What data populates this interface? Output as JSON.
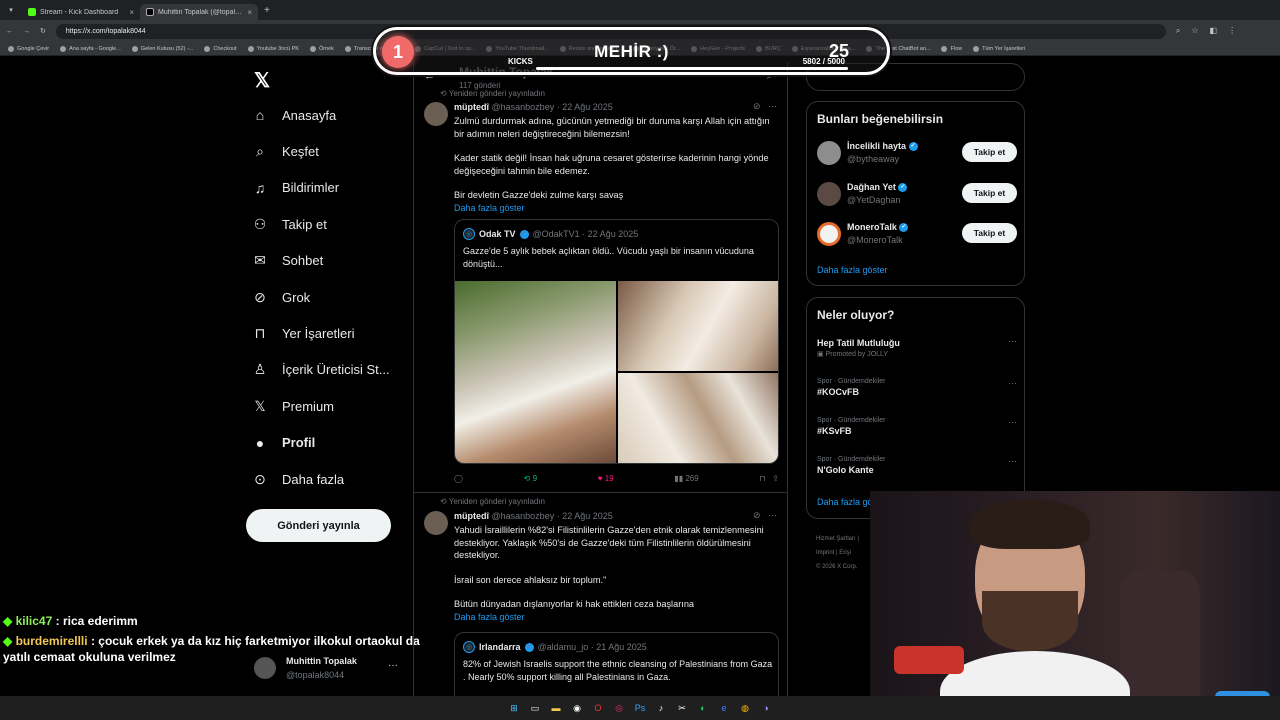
{
  "browser": {
    "tabs": [
      {
        "title": "Stream - Kick Dashboard",
        "icon": "kick-icon"
      },
      {
        "title": "Muhittin Topalak (@topalak804...",
        "icon": "x-icon"
      }
    ],
    "url": "https://x.com/topalak8044",
    "bookmarks": [
      "Google Çevir",
      "Ana sayfa - Google...",
      "Gelen Kutusu (52) -...",
      "Checkout",
      "Youtube 3ncü PK",
      "Örnek",
      "Transcript of \"Mi M...",
      "CapCut | Text to sp...",
      "YouTube Thumbnail...",
      "Resize and reduce i...",
      "İspanyolca Ör...",
      "HeyGen - Projects",
      "BURÇ",
      "Esperanza000 Strea...",
      "The best ChatBot an...",
      "Flow",
      "Tüm Yer İşaretleri"
    ]
  },
  "overlay": {
    "badge": "1",
    "name": "MEHİR :)",
    "target": "25",
    "label": "KICKS",
    "count": "5802 / 5000",
    "progress": 1.0
  },
  "x_nav": {
    "items": [
      {
        "label": "Anasayfa",
        "icon": "home-icon"
      },
      {
        "label": "Keşfet",
        "icon": "search-icon"
      },
      {
        "label": "Bildirimler",
        "icon": "bell-icon"
      },
      {
        "label": "Takip et",
        "icon": "person-add-icon"
      },
      {
        "label": "Sohbet",
        "icon": "mail-icon"
      },
      {
        "label": "Grok",
        "icon": "grok-icon"
      },
      {
        "label": "Yer İşaretleri",
        "icon": "bookmark-icon"
      },
      {
        "label": "İçerik Üreticisi St...",
        "icon": "creator-icon"
      },
      {
        "label": "Premium",
        "icon": "x-premium-icon"
      },
      {
        "label": "Profil",
        "icon": "profile-icon"
      },
      {
        "label": "Daha fazla",
        "icon": "more-circle-icon"
      }
    ],
    "post_button": "Gönderi yayınla",
    "profile": {
      "name": "Muhittin Topalak",
      "handle": "@topalak8044"
    }
  },
  "chat": [
    {
      "user": "kilic47",
      "message": ": rica ederimm"
    },
    {
      "user": "burdemirellli",
      "message": ": çocuk erkek ya da kız hiç farketmiyor ilkokul ortaokul da yatılı cemaat okuluna verilmez"
    }
  ],
  "feed": {
    "header_name": "Muhittin Topalak",
    "post_count": "117 gönderi",
    "tweets": [
      {
        "repost_label": "Yeniden gönderi yayınladın",
        "name": "müptedî",
        "handle": "@hasanbozbey · 22 Ağu 2025",
        "paragraphs": [
          "Zulmü durdurmak adına, gücünün yetmediği bir duruma karşı Allah için attığın bir adımın neleri değiştireceğini bilemezsin!",
          "Kader statik değil! İnsan hak uğruna cesaret gösterirse kaderinin hangi yönde değişeceğini tahmin bile edemez.",
          "Bir devletin Gazze'deki zulme karşı savaş"
        ],
        "show_more": "Daha fazla göster",
        "quote": {
          "name": "Odak TV",
          "handle": "@OdakTV1 · 22 Ağu 2025",
          "text": "Gazze'de 5 aylık bebek açlıktan öldü.. Vücudu yaşlı bir insanın vücuduna dönüştü..."
        },
        "stats": {
          "reposts": "9",
          "likes": "19",
          "views": "269"
        }
      },
      {
        "repost_label": "Yeniden gönderi yayınladın",
        "name": "müptedî",
        "handle": "@hasanbozbey · 22 Ağu 2025",
        "paragraphs": [
          "Yahudi İsraillilerin %82'si Filistinlilerin Gazze'den etnik olarak temizlenmesini destekliyor. Yaklaşık %50'si de Gazze'deki tüm Filistinlilerin öldürülmesini destekliyor.",
          "İsrail son derece ahlaksız bir toplum.\"",
          "Bütün dünyadan dışlanıyorlar ki hak ettikleri ceza başlarına"
        ],
        "show_more": "Daha fazla göster",
        "quote": {
          "name": "Irlandarra",
          "handle": "@aldamu_jo · 21 Ağu 2025",
          "text": "82% of Jewish Israelis support the ethnic cleansing of Palestinians from Gaza . Nearly 50% support killing all Palestinians in Gaza."
        }
      }
    ]
  },
  "sidebar": {
    "who_to_follow_title": "Bunları beğenebilirsin",
    "suggestions": [
      {
        "name": "İncelikli hayta",
        "handle": "@bytheaway",
        "button": "Takip et"
      },
      {
        "name": "Dağhan Yet",
        "handle": "@YetDaghan",
        "button": "Takip et"
      },
      {
        "name": "MoneroTalk",
        "handle": "@MoneroTalk",
        "button": "Takip et"
      }
    ],
    "show_more": "Daha fazla göster",
    "trends_title": "Neler oluyor?",
    "trends": [
      {
        "category": "",
        "name": "Hep Tatil Mutluluğu",
        "promoted": "Promoted by JOLLY"
      },
      {
        "category": "Spor · Gündemdekiler",
        "name": "#KOCvFB",
        "promoted": ""
      },
      {
        "category": "Spor · Gündemdekiler",
        "name": "#KSvFB",
        "promoted": ""
      },
      {
        "category": "Spor · Gündemdekiler",
        "name": "N'Golo Kante",
        "promoted": ""
      }
    ],
    "trends_more": "Daha fazla gö",
    "footer": [
      "Hizmet Şartları",
      "Imprint",
      "Erişi",
      "© 2026 X Corp."
    ]
  }
}
